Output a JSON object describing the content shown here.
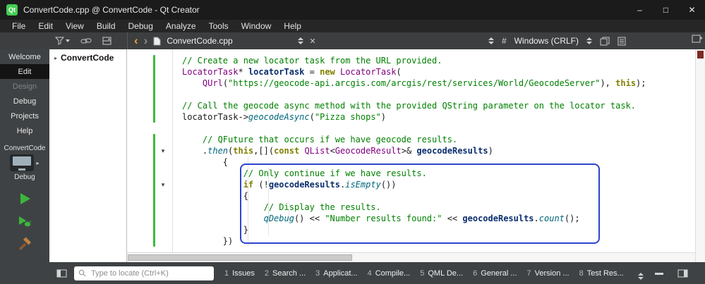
{
  "titlebar": {
    "app_icon_text": "Qt",
    "title": "ConvertCode.cpp @ ConvertCode - Qt Creator",
    "minimize": "–",
    "maximize": "□",
    "close": "✕"
  },
  "menubar": [
    "File",
    "Edit",
    "View",
    "Build",
    "Debug",
    "Analyze",
    "Tools",
    "Window",
    "Help"
  ],
  "toolbar": {
    "document_name": "ConvertCode.cpp",
    "hash": "#",
    "line_ending": "Windows (CRLF)"
  },
  "icons": {
    "fold_down": "▾",
    "chevron_right": "▸",
    "back_arrow": "‹",
    "forward_arrow": "›",
    "close": "✕"
  },
  "modebar": {
    "modes": [
      {
        "label": "Welcome",
        "state": "normal"
      },
      {
        "label": "Edit",
        "state": "active"
      },
      {
        "label": "Design",
        "state": "disabled"
      },
      {
        "label": "Debug",
        "state": "normal"
      },
      {
        "label": "Projects",
        "state": "normal"
      },
      {
        "label": "Help",
        "state": "normal"
      }
    ],
    "project_name": "ConvertCode",
    "build_config": "Debug"
  },
  "project_tree": {
    "root_label": "ConvertCode"
  },
  "editor": {
    "code": [
      [
        [
          "c",
          "// Create a new locator task from the URL provided."
        ]
      ],
      [
        [
          "t",
          "LocatorTask"
        ],
        [
          "p",
          "* "
        ],
        [
          "v",
          "locatorTask"
        ],
        [
          "p",
          " = "
        ],
        [
          "k",
          "new"
        ],
        [
          "p",
          " "
        ],
        [
          "t",
          "LocatorTask"
        ],
        [
          "p",
          "("
        ]
      ],
      [
        [
          "p",
          "    "
        ],
        [
          "t",
          "QUrl"
        ],
        [
          "p",
          "("
        ],
        [
          "s",
          "\"https://geocode-api.arcgis.com/arcgis/rest/services/World/GeocodeServer\""
        ],
        [
          "p",
          "), "
        ],
        [
          "k",
          "this"
        ],
        [
          "p",
          ");"
        ]
      ],
      [],
      [
        [
          "c",
          "// Call the geocode async method with the provided QString parameter on the locator task."
        ]
      ],
      [
        [
          "p",
          "locatorTask->"
        ],
        [
          "f",
          "geocodeAsync"
        ],
        [
          "p",
          "("
        ],
        [
          "s",
          "\"Pizza shops\""
        ],
        [
          "p",
          ")"
        ]
      ],
      [],
      [
        [
          "p",
          "    "
        ],
        [
          "c",
          "// QFuture that occurs if we have geocode results."
        ]
      ],
      [
        [
          "p",
          "    ."
        ],
        [
          "f",
          "then"
        ],
        [
          "p",
          "("
        ],
        [
          "k",
          "this"
        ],
        [
          "p",
          ",[]("
        ],
        [
          "k",
          "const"
        ],
        [
          "p",
          " "
        ],
        [
          "t",
          "QList"
        ],
        [
          "p",
          "<"
        ],
        [
          "t",
          "GeocodeResult"
        ],
        [
          "p",
          ">& "
        ],
        [
          "v",
          "geocodeResults"
        ],
        [
          "p",
          ")"
        ]
      ],
      [
        [
          "p",
          "        {"
        ]
      ],
      [
        [
          "p",
          "            "
        ],
        [
          "c",
          "// Only continue if we have results."
        ]
      ],
      [
        [
          "p",
          "            "
        ],
        [
          "k",
          "if"
        ],
        [
          "p",
          " (!"
        ],
        [
          "v",
          "geocodeResults"
        ],
        [
          "p",
          "."
        ],
        [
          "f",
          "isEmpty"
        ],
        [
          "p",
          "())"
        ]
      ],
      [
        [
          "p",
          "            {"
        ]
      ],
      [
        [
          "p",
          "                "
        ],
        [
          "c",
          "// Display the results."
        ]
      ],
      [
        [
          "p",
          "                "
        ],
        [
          "f",
          "qDebug"
        ],
        [
          "p",
          "() << "
        ],
        [
          "s",
          "\"Number results found:\""
        ],
        [
          "p",
          " << "
        ],
        [
          "v",
          "geocodeResults"
        ],
        [
          "p",
          "."
        ],
        [
          "f",
          "count"
        ],
        [
          "p",
          "();"
        ]
      ],
      [
        [
          "p",
          "            }"
        ]
      ],
      [
        [
          "p",
          "        })"
        ]
      ]
    ]
  },
  "statusbar": {
    "locator_placeholder": "Type to locate (Ctrl+K)",
    "output_panes": [
      {
        "index": "1",
        "label": "Issues"
      },
      {
        "index": "2",
        "label": "Search ..."
      },
      {
        "index": "3",
        "label": "Applicat..."
      },
      {
        "index": "4",
        "label": "Compile..."
      },
      {
        "index": "5",
        "label": "QML De..."
      },
      {
        "index": "6",
        "label": "General ..."
      },
      {
        "index": "7",
        "label": "Version ..."
      },
      {
        "index": "8",
        "label": "Test Res..."
      }
    ]
  },
  "colors": {
    "qtGreen": "#41cd52",
    "comment": "#008000",
    "string": "#008000",
    "keyword": "#808000",
    "type": "#800080",
    "local": "#0a2e6e",
    "func": "#00677c",
    "boxBlue": "#2c45cf",
    "runGreen": "#3cb53c",
    "hammerOrange": "#c08040",
    "backOrange": "#e8a33d",
    "vcsGreen": "#3dbb3d",
    "redMark": "#7b2b24"
  }
}
